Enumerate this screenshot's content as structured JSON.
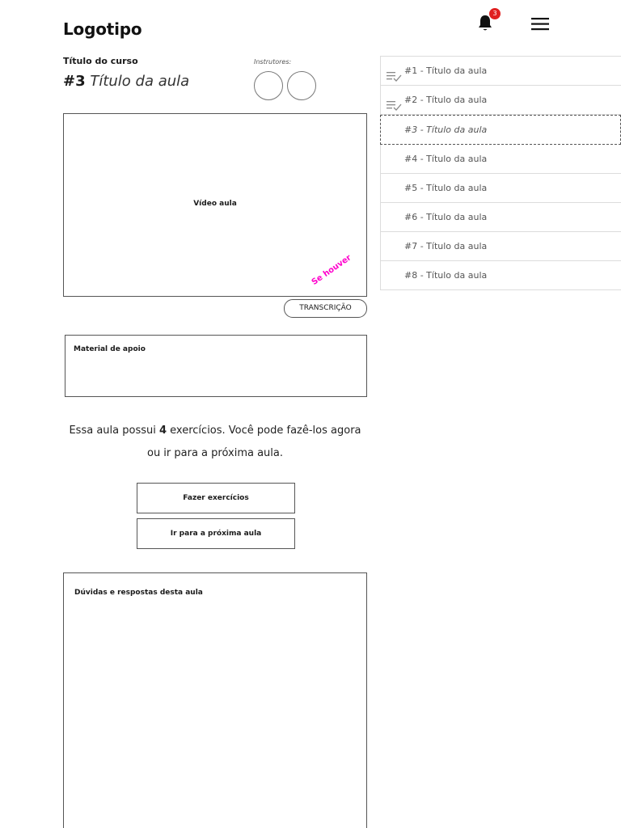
{
  "header": {
    "logo": "Logotipo",
    "notification_count": "3"
  },
  "course": {
    "title": "Título do curso",
    "lesson_number": "#3",
    "lesson_title": "Título da aula",
    "instructors_label": "Instrutores:"
  },
  "video": {
    "label": "Vídeo aula",
    "annotation": "Se houver",
    "transcript_button": "TRANSCRIÇÃO"
  },
  "material": {
    "label": "Material de apoio"
  },
  "exercises": {
    "text_before": "Essa aula possui ",
    "count": "4",
    "text_after": " exercícios. Você pode fazê-los agora ou ir para a próxima aula.",
    "do_button": "Fazer exercícios",
    "next_button": "Ir para a próxima aula"
  },
  "qa": {
    "label": "Dúvidas e respostas desta aula"
  },
  "lessons": [
    {
      "label": "#1 - Título da aula",
      "completed": true
    },
    {
      "label": "#2 - Título da aula",
      "completed": true
    },
    {
      "label": "#3 - Título da aula",
      "current": true
    },
    {
      "label": "#4 - Título da aula"
    },
    {
      "label": "#5 - Título da aula"
    },
    {
      "label": "#6 - Título da aula"
    },
    {
      "label": "#7 - Título da aula"
    },
    {
      "label": "#8 - Título da aula"
    }
  ],
  "icons": {
    "notification": "bell-icon",
    "menu": "hamburger-menu-icon",
    "completed": "playlist-check-icon"
  },
  "colors": {
    "badge": "#e02020",
    "annotation": "#ff00cc"
  }
}
